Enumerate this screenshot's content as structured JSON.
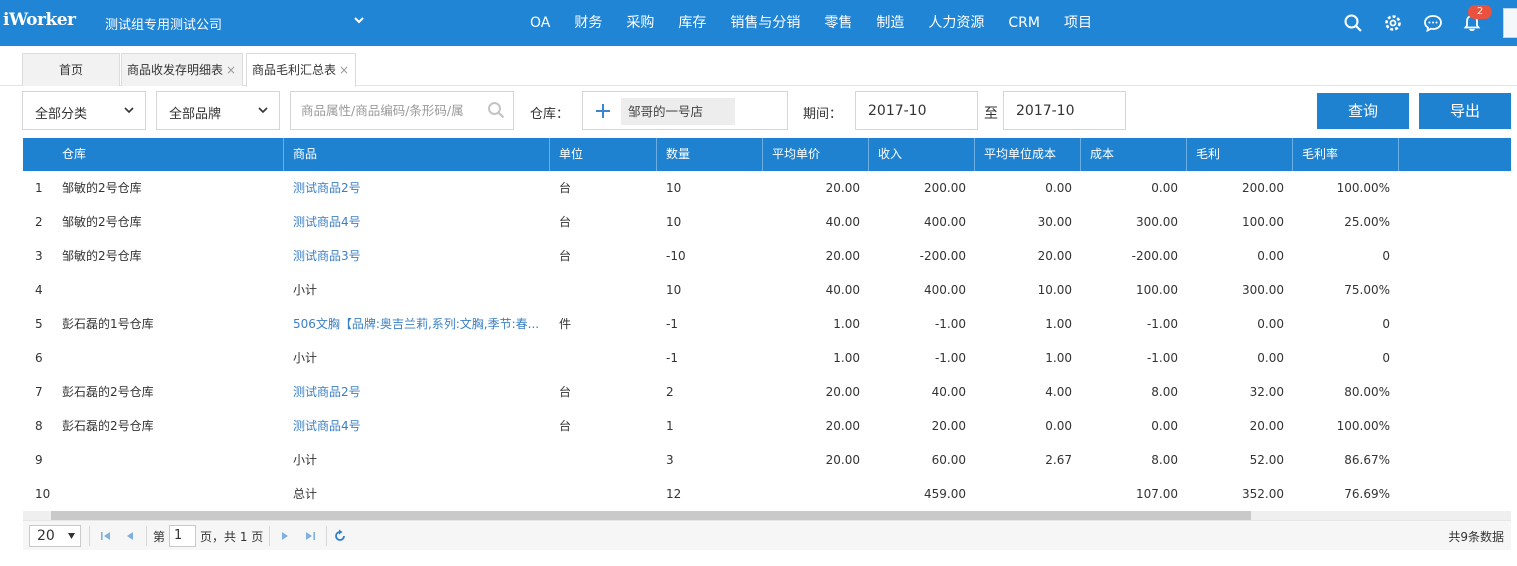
{
  "app": {
    "logo": "iWorker",
    "company": "测试组专用测试公司",
    "nav": [
      "OA",
      "财务",
      "采购",
      "库存",
      "销售与分销",
      "零售",
      "制造",
      "人力资源",
      "CRM",
      "项目"
    ],
    "notification_count": "2",
    "icons": [
      "search-icon",
      "gear-icon",
      "chat-icon",
      "bell-icon"
    ],
    "accent_color": "#2185d6"
  },
  "tabs": [
    {
      "label": "首页"
    },
    {
      "label": "商品收发存明细表",
      "close": "×"
    },
    {
      "label": "商品毛利汇总表",
      "close": "×"
    }
  ],
  "filters": {
    "category": "全部分类",
    "brand": "全部品牌",
    "search_placeholder": "商品属性/商品编码/条形码/属",
    "warehouse_label": "仓库：",
    "warehouse_chip": "邹哥的一号店",
    "period_label": "期间：",
    "period_start": "2017-10",
    "period_to": "至",
    "period_end": "2017-10",
    "query_button": "查询",
    "export_button": "导出"
  },
  "table": {
    "columns": [
      "仓库",
      "商品",
      "单位",
      "数量",
      "平均单价",
      "收入",
      "平均单位成本",
      "成本",
      "毛利",
      "毛利率"
    ],
    "rows": [
      {
        "idx": "1",
        "warehouse": "邹敏的2号仓库",
        "product": "测试商品2号",
        "link": true,
        "unit": "台",
        "qty": "10",
        "avg_price": "20.00",
        "revenue": "200.00",
        "avg_cost": "0.00",
        "cost": "0.00",
        "profit": "200.00",
        "margin": "100.00%"
      },
      {
        "idx": "2",
        "warehouse": "邹敏的2号仓库",
        "product": "测试商品4号",
        "link": true,
        "unit": "台",
        "qty": "10",
        "avg_price": "40.00",
        "revenue": "400.00",
        "avg_cost": "30.00",
        "cost": "300.00",
        "profit": "100.00",
        "margin": "25.00%"
      },
      {
        "idx": "3",
        "warehouse": "邹敏的2号仓库",
        "product": "测试商品3号",
        "link": true,
        "unit": "台",
        "qty": "-10",
        "avg_price": "20.00",
        "revenue": "-200.00",
        "avg_cost": "20.00",
        "cost": "-200.00",
        "profit": "0.00",
        "margin": "0"
      },
      {
        "idx": "4",
        "warehouse": "",
        "product": "小计",
        "link": false,
        "unit": "",
        "qty": "10",
        "avg_price": "40.00",
        "revenue": "400.00",
        "avg_cost": "10.00",
        "cost": "100.00",
        "profit": "300.00",
        "margin": "75.00%"
      },
      {
        "idx": "5",
        "warehouse": "彭石磊的1号仓库",
        "product": "506文胸【品牌:奥吉兰莉,系列:文胸,季节:春...",
        "link": true,
        "unit": "件",
        "qty": "-1",
        "avg_price": "1.00",
        "revenue": "-1.00",
        "avg_cost": "1.00",
        "cost": "-1.00",
        "profit": "0.00",
        "margin": "0"
      },
      {
        "idx": "6",
        "warehouse": "",
        "product": "小计",
        "link": false,
        "unit": "",
        "qty": "-1",
        "avg_price": "1.00",
        "revenue": "-1.00",
        "avg_cost": "1.00",
        "cost": "-1.00",
        "profit": "0.00",
        "margin": "0"
      },
      {
        "idx": "7",
        "warehouse": "彭石磊的2号仓库",
        "product": "测试商品2号",
        "link": true,
        "unit": "台",
        "qty": "2",
        "avg_price": "20.00",
        "revenue": "40.00",
        "avg_cost": "4.00",
        "cost": "8.00",
        "profit": "32.00",
        "margin": "80.00%"
      },
      {
        "idx": "8",
        "warehouse": "彭石磊的2号仓库",
        "product": "测试商品4号",
        "link": true,
        "unit": "台",
        "qty": "1",
        "avg_price": "20.00",
        "revenue": "20.00",
        "avg_cost": "0.00",
        "cost": "0.00",
        "profit": "20.00",
        "margin": "100.00%"
      },
      {
        "idx": "9",
        "warehouse": "",
        "product": "小计",
        "link": false,
        "unit": "",
        "qty": "3",
        "avg_price": "20.00",
        "revenue": "60.00",
        "avg_cost": "2.67",
        "cost": "8.00",
        "profit": "52.00",
        "margin": "86.67%"
      },
      {
        "idx": "10",
        "warehouse": "",
        "product": "总计",
        "link": false,
        "unit": "",
        "qty": "12",
        "avg_price": "",
        "revenue": "459.00",
        "avg_cost": "",
        "cost": "107.00",
        "profit": "352.00",
        "margin": "76.69%"
      }
    ]
  },
  "pager": {
    "page_size": "20",
    "page_prefix": "第",
    "page_current": "1",
    "page_suffix": "页，共 1 页",
    "total_text": "共9条数据"
  }
}
